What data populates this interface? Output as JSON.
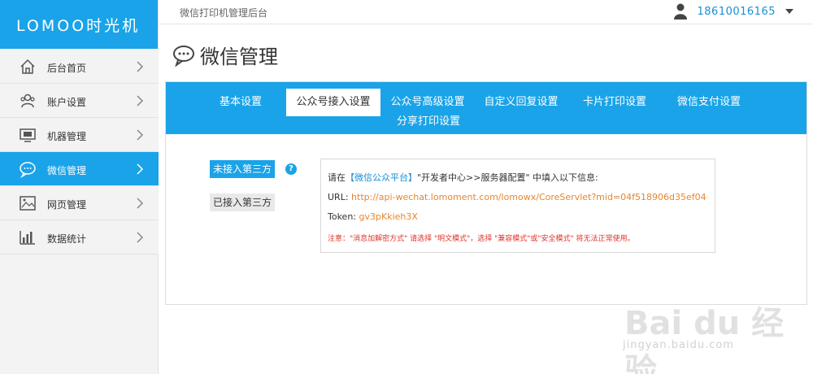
{
  "app": {
    "logo_text": "LOMOO时光机",
    "header_title": "微信打印机管理后台",
    "user_phone": "18610016165"
  },
  "sidebar": {
    "items": [
      {
        "label": "后台首页",
        "icon": "home-icon"
      },
      {
        "label": "账户设置",
        "icon": "users-icon"
      },
      {
        "label": "机器管理",
        "icon": "monitor-icon"
      },
      {
        "label": "微信管理",
        "icon": "chat-icon",
        "active": true
      },
      {
        "label": "网页管理",
        "icon": "image-icon"
      },
      {
        "label": "数据统计",
        "icon": "chart-icon"
      }
    ]
  },
  "page": {
    "title": "微信管理"
  },
  "tabs": [
    {
      "label": "基本设置"
    },
    {
      "label": "公众号接入设置",
      "active": true
    },
    {
      "label": "公众号高级设置"
    },
    {
      "label": "自定义回复设置"
    },
    {
      "label": "卡片打印设置"
    },
    {
      "label": "微信支付设置"
    },
    {
      "label": "分享打印设置"
    }
  ],
  "access": {
    "btn_not_connected": "未接入第三方",
    "btn_connected": "已接入第三方",
    "help": "?",
    "instr_prefix": "请在",
    "instr_link": "【微信公众平台】",
    "instr_suffix": "\"开发者中心>>服务器配置\" 中填入以下信息:",
    "url_label": "URL:",
    "url_value": "http://api-wechat.lomoment.com/lomowx/CoreServlet?mid=04f518906d35ef04",
    "token_label": "Token:",
    "token_value": "gv3pKkieh3X",
    "warning": "注意：\"消息加解密方式\" 请选择 \"明文模式\"，选择 \"兼容模式\"或\"安全模式\" 将无法正常使用。"
  },
  "watermark": {
    "main": "Bai du 经验",
    "sub": "jingyan.baidu.com"
  },
  "colors": {
    "primary": "#1aa3e8",
    "link": "#1a8fd6",
    "token": "#e6862f",
    "warning": "#e0342a"
  }
}
